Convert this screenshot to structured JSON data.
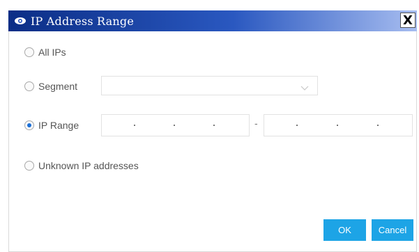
{
  "dialog": {
    "title": "IP Address Range",
    "close_label": "X",
    "icons": {
      "title": "eye-icon",
      "close": "close-icon",
      "dropdown": "chevron-down-icon"
    },
    "colors": {
      "title_gradient_start": "#0b2e86",
      "title_gradient_end": "#a7bdf0",
      "button": "#1da4e6",
      "radio_selected": "#1b6fd6"
    }
  },
  "options": {
    "all_ips": {
      "label": "All IPs",
      "selected": false
    },
    "segment": {
      "label": "Segment",
      "selected": false,
      "value": ""
    },
    "ip_range": {
      "label": "IP Range",
      "selected": true,
      "separator": "-",
      "start": "",
      "end": ""
    },
    "unknown": {
      "label": "Unknown IP addresses",
      "selected": false
    }
  },
  "buttons": {
    "ok": "OK",
    "cancel": "Cancel"
  }
}
